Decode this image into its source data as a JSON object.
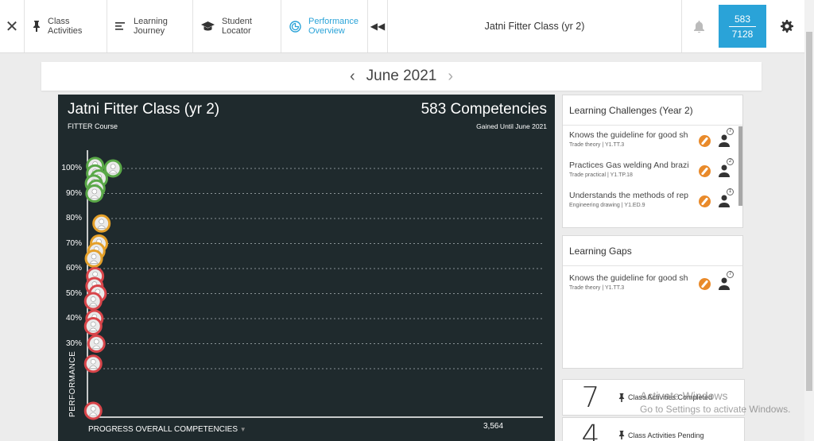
{
  "nav": {
    "items": [
      {
        "label": "Class Activities",
        "icon": "pin-icon",
        "active": false
      },
      {
        "label": "Learning Journey",
        "icon": "list-icon",
        "active": false
      },
      {
        "label": "Student Locator",
        "icon": "graduation-cap-icon",
        "active": false
      },
      {
        "label": "Performance Overview",
        "icon": "chart-circle-icon",
        "active": true
      }
    ],
    "title": "Jatni Fitter Class (yr 2)",
    "counter_top": "583",
    "counter_bottom": "7128",
    "accent": "#2aa3d8"
  },
  "month": {
    "label": "June 2021"
  },
  "panel": {
    "title": "Jatni Fitter Class (yr 2)",
    "subtitle": "FITTER Course",
    "competencies": "583 Competencies",
    "gained": "Gained Until June 2021"
  },
  "chart_data": {
    "type": "scatter",
    "ylabel": "PERFORMANCE",
    "xlabel": "PROGRESS OVERALL COMPETENCIES",
    "x_max_label": "3,564",
    "xlim": [
      0,
      3564
    ],
    "ylim": [
      0,
      100
    ],
    "y_ticks": [
      "100%",
      "90%",
      "80%",
      "70%",
      "60%",
      "50%",
      "40%",
      "30%"
    ],
    "y_tick_values": [
      100,
      90,
      80,
      70,
      60,
      50,
      40,
      30
    ],
    "grid": true,
    "colors": {
      "high": "#5aa848",
      "mid": "#e4a02a",
      "low": "#d8454a",
      "background": "#1f2a2d"
    },
    "points": [
      {
        "x": 60,
        "y": 101,
        "band": "high"
      },
      {
        "x": 200,
        "y": 100,
        "band": "high"
      },
      {
        "x": 60,
        "y": 98,
        "band": "high"
      },
      {
        "x": 90,
        "y": 96,
        "band": "high"
      },
      {
        "x": 50,
        "y": 94,
        "band": "high"
      },
      {
        "x": 70,
        "y": 92,
        "band": "high"
      },
      {
        "x": 55,
        "y": 90,
        "band": "high"
      },
      {
        "x": 110,
        "y": 78,
        "band": "mid"
      },
      {
        "x": 90,
        "y": 70,
        "band": "mid"
      },
      {
        "x": 70,
        "y": 67,
        "band": "mid"
      },
      {
        "x": 50,
        "y": 64,
        "band": "mid"
      },
      {
        "x": 60,
        "y": 57,
        "band": "low"
      },
      {
        "x": 55,
        "y": 53,
        "band": "low"
      },
      {
        "x": 80,
        "y": 50,
        "band": "low"
      },
      {
        "x": 45,
        "y": 47,
        "band": "low"
      },
      {
        "x": 55,
        "y": 40,
        "band": "low"
      },
      {
        "x": 45,
        "y": 37,
        "band": "low"
      },
      {
        "x": 70,
        "y": 30,
        "band": "low"
      },
      {
        "x": 45,
        "y": 22,
        "band": "low"
      },
      {
        "x": 45,
        "y": 2,
        "band": "low"
      }
    ]
  },
  "challenges": {
    "title": "Learning Challenges (Year 2)",
    "items": [
      {
        "text": "Knows the guideline for good sh...",
        "meta": "Trade theory | Y1.TT.3",
        "count": "7"
      },
      {
        "text": "Practices Gas welding And brazing",
        "meta": "Trade practical | Y1.TP.18",
        "count": "2"
      },
      {
        "text": "Understands the methods of rep...",
        "meta": "Engineering drawing | Y1.ED.9",
        "count": "1"
      }
    ]
  },
  "gaps": {
    "title": "Learning Gaps",
    "items": [
      {
        "text": "Knows the guideline for good sh...",
        "meta": "Trade theory | Y1.TT.3",
        "count": "7"
      }
    ]
  },
  "stats": [
    {
      "num": "7",
      "label": "Class Activities Completed"
    },
    {
      "num": "4",
      "label": "Class Activities Pending"
    }
  ],
  "watermark": {
    "line1": "Activate Windows",
    "line2": "Go to Settings to activate Windows."
  }
}
